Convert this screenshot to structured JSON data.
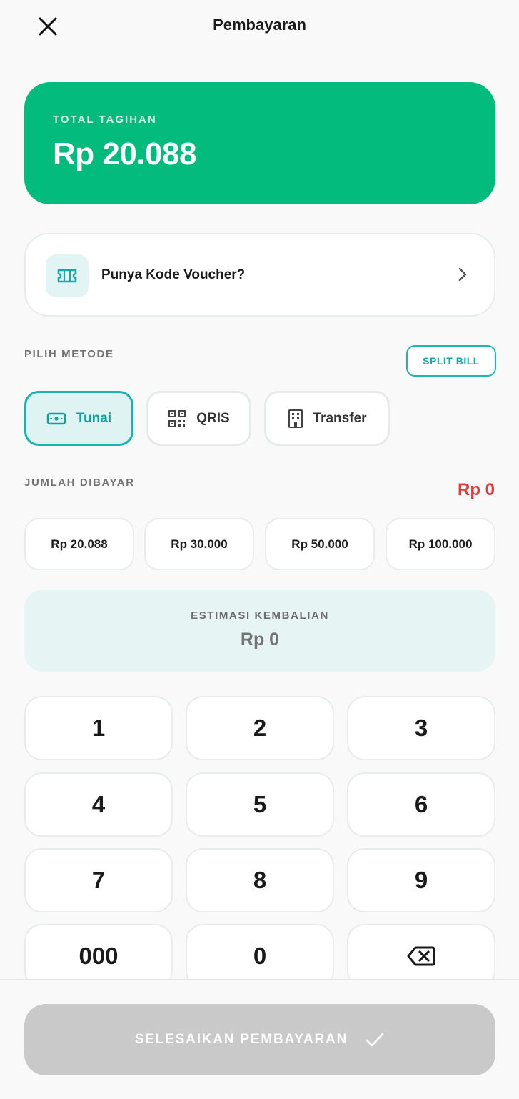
{
  "header": {
    "title": "Pembayaran",
    "close_icon": "close-icon"
  },
  "total": {
    "label": "TOTAL TAGIHAN",
    "value": "Rp 20.088"
  },
  "voucher": {
    "label": "Punya Kode Voucher?",
    "icon": "ticket-icon"
  },
  "method_section": {
    "label": "PILIH METODE",
    "split_bill_label": "SPLIT BILL",
    "methods": [
      {
        "label": "Tunai",
        "icon": "cash-icon",
        "selected": true
      },
      {
        "label": "QRIS",
        "icon": "qr-code-icon",
        "selected": false
      },
      {
        "label": "Transfer",
        "icon": "bank-building-icon",
        "selected": false
      }
    ]
  },
  "paid_section": {
    "label": "JUMLAH DIBAYAR",
    "amount": "Rp 0",
    "quick_amounts": [
      "Rp 20.088",
      "Rp 30.000",
      "Rp 50.000",
      "Rp 100.000"
    ]
  },
  "change": {
    "label": "ESTIMASI KEMBALIAN",
    "value": "Rp 0"
  },
  "keypad": {
    "keys": [
      "1",
      "2",
      "3",
      "4",
      "5",
      "6",
      "7",
      "8",
      "9",
      "000",
      "0"
    ],
    "backspace_icon": "backspace-icon"
  },
  "footer": {
    "finish_label": "SELESAIKAN PEMBAYARAN",
    "finish_icon": "checkmark-icon"
  },
  "colors": {
    "brand_green": "#02bb7d",
    "accent_teal": "#18b3ae",
    "alert_red": "#e23b3b",
    "disabled_gray": "#c9c9c9"
  }
}
